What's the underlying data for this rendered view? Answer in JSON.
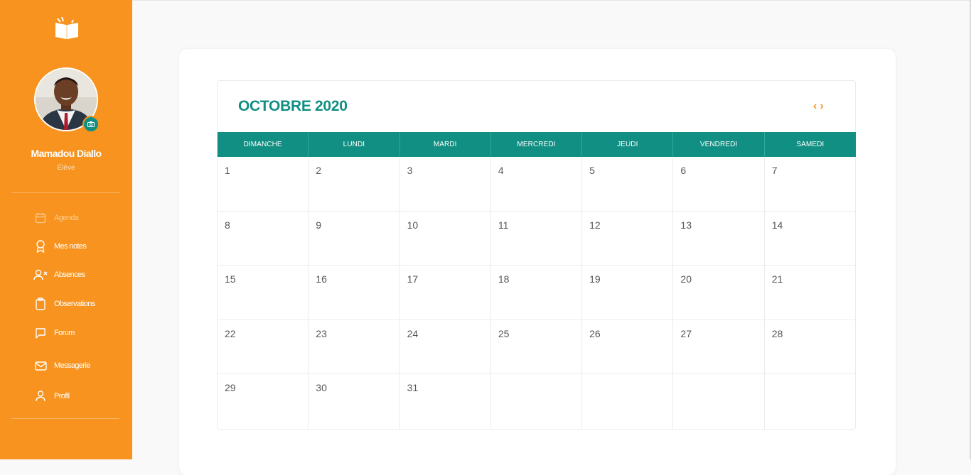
{
  "sidebar": {
    "logo_icon": "open-book-logo-icon",
    "user_name": "Mamadou Diallo",
    "user_role": "Élève",
    "nav": [
      {
        "label": "Agenda",
        "icon": "calendar-icon"
      },
      {
        "label": "Mes notes",
        "icon": "award-icon"
      },
      {
        "label": "Absences",
        "icon": "user-x-icon"
      },
      {
        "label": "Observations",
        "icon": "clipboard-icon"
      },
      {
        "label": "Forum",
        "icon": "chat-icon"
      },
      {
        "label": "Messagerie",
        "icon": "mail-icon"
      },
      {
        "label": "Profil",
        "icon": "user-icon"
      }
    ]
  },
  "calendar": {
    "title": "OCTOBRE 2020",
    "prev_label": "‹",
    "next_label": "›",
    "weekdays": [
      "DIMANCHE",
      "LUNDI",
      "MARDI",
      "MERCREDI",
      "JEUDI",
      "VENDREDI",
      "SAMEDI"
    ],
    "days": [
      "1",
      "2",
      "3",
      "4",
      "5",
      "6",
      "7",
      "8",
      "9",
      "10",
      "11",
      "12",
      "13",
      "14",
      "15",
      "16",
      "17",
      "18",
      "19",
      "20",
      "21",
      "22",
      "23",
      "24",
      "25",
      "26",
      "27",
      "28",
      "29",
      "30",
      "31",
      "",
      "",
      "",
      ""
    ]
  },
  "colors": {
    "accent_orange": "#f7931e",
    "teal": "#128f83"
  }
}
